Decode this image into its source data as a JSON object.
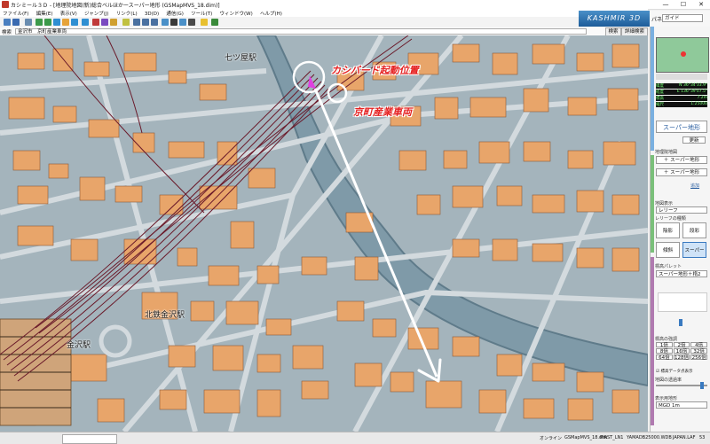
{
  "window": {
    "title": "カシミール３Ｄ - [地理院地図(新)総合ベルほかースーパー地形 (GSMapMVS_18.dim)]",
    "minimize": "—",
    "maximize": "☐",
    "close": "✕"
  },
  "menu": [
    "ファイル(F)",
    "編集(E)",
    "表示(V)",
    "ジャンプ(J)",
    "リンク(L)",
    "3D(D)",
    "通信(G)",
    "ツール(T)",
    "ウィンドウ(W)",
    "ヘルプ(H)"
  ],
  "brand": "KASHMIR 3D",
  "panel": {
    "label": "パネル",
    "select": "ガイド"
  },
  "search": {
    "label": "検索",
    "value": "金沢市　京町産業車両",
    "button": "検索",
    "button2": "詳細検索"
  },
  "map": {
    "labels": {
      "station_nanatsuya": "七ツ屋駅",
      "station_kitatetsu": "北鉄金沢駅",
      "station_kanazawa": "金沢駅",
      "callout_start": "カシバード起動位置",
      "callout_company": "京町産業車両"
    }
  },
  "sidebar": {
    "coords": [
      {
        "label": "緯度",
        "value": "N 36°34'33.9\""
      },
      {
        "label": "経度",
        "value": "E 136°39'07.5\""
      },
      {
        "label": "標高",
        "value": "7.2m"
      },
      {
        "label": "縮尺",
        "value": "1:25000"
      }
    ],
    "supermap_button": "スーパー地形",
    "update_label": "更新",
    "map_change_title": "地理院地図",
    "plus_btn1": "＋ スーパー地形",
    "plus_btn2": "＋ スーパー地形",
    "more_link": "追加",
    "layer_title": "地図表示",
    "layer_select": "レリーフ",
    "layer_type_title": "レリーフの種類",
    "mode_buttons": [
      "陰影",
      "段彩",
      "傾斜",
      "スーパー"
    ],
    "palette_title": "標高パレット",
    "palette_select": "スーパー地形＋楕2",
    "scale_title": "標高の強調",
    "scale_values": [
      "1倍",
      "2倍",
      "4倍",
      "8倍",
      "16倍",
      "32倍",
      "64倍",
      "128倍",
      "256倍"
    ],
    "checkbox_label": "標高データ点表示",
    "opacity_label": "地図の透過率",
    "display_title": "表示用地形",
    "display_select": "MGD 1m"
  },
  "status": {
    "online": "オンライン",
    "file": "GSMapMVS_18.dim",
    "mesh": "PIRST_LN1",
    "code": "YAMADB25000.WDB",
    "dir": "JAPAN.LAF",
    "num": "53"
  },
  "colors": {
    "building": "#e8a56a",
    "road": "#c8d2d6",
    "terrain": "#9fb0b8",
    "river": "#88a2b0",
    "rail": "#6a1a2a",
    "callout": "#e52020"
  }
}
